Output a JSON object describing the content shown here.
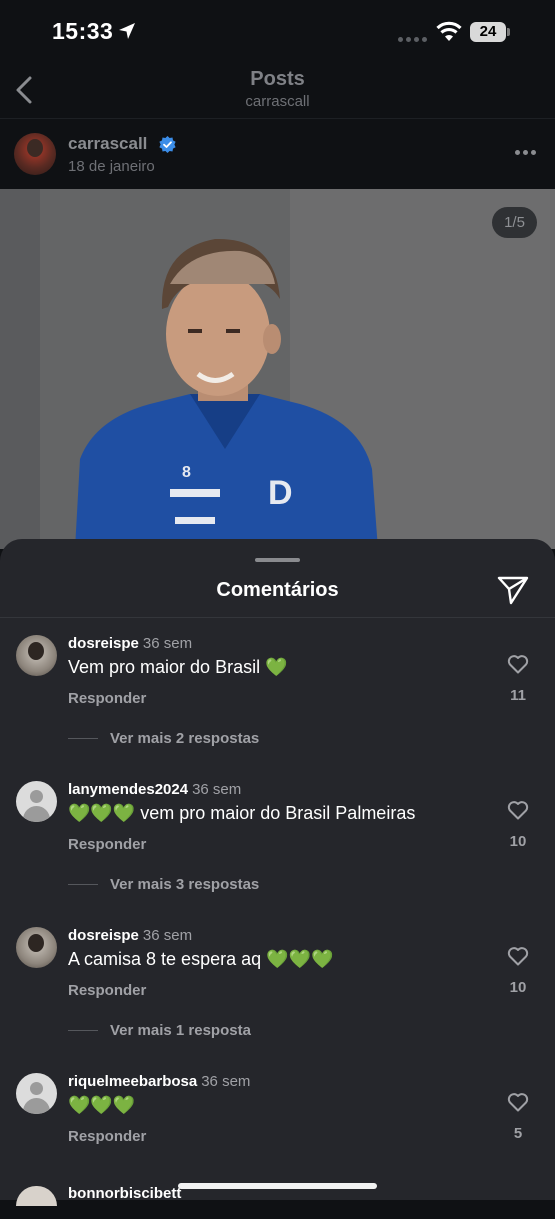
{
  "status_bar": {
    "time": "15:33",
    "battery": "24"
  },
  "header": {
    "title": "Posts",
    "subtitle": "carrascall"
  },
  "post": {
    "author": "carrascall",
    "date": "18 de janeiro",
    "counter": "1/5"
  },
  "comments_sheet": {
    "title": "Comentários",
    "reply_label": "Responder",
    "comments": [
      {
        "user": "dosreispe",
        "time": "36 sem",
        "text": "Vem pro maior do Brasil 💚",
        "likes": "11",
        "more_replies": "Ver mais 2 respostas",
        "avatar": "photo"
      },
      {
        "user": "lanymendes2024",
        "time": "36 sem",
        "text": "💚💚💚 vem pro maior do Brasil Palmeiras",
        "likes": "10",
        "more_replies": "Ver mais 3 respostas",
        "avatar": "default"
      },
      {
        "user": "dosreispe",
        "time": "36 sem",
        "text": "A camisa 8 te espera aq 💚💚💚",
        "likes": "10",
        "more_replies": "Ver mais 1 resposta",
        "avatar": "photo"
      },
      {
        "user": "riquelmeebarbosa",
        "time": "36 sem",
        "text": "💚💚💚",
        "likes": "5",
        "avatar": "default"
      }
    ],
    "partial_user": "bonnorbiscibett"
  },
  "colors": {
    "background": "#0f1114",
    "sheet": "#25262b",
    "verified": "#3b8de8",
    "secondary_text": "#a0a1a6"
  },
  "icons": [
    "location-arrow-icon",
    "wifi-icon",
    "back-chevron-icon",
    "verified-badge-icon",
    "more-icon",
    "send-icon",
    "heart-icon"
  ]
}
